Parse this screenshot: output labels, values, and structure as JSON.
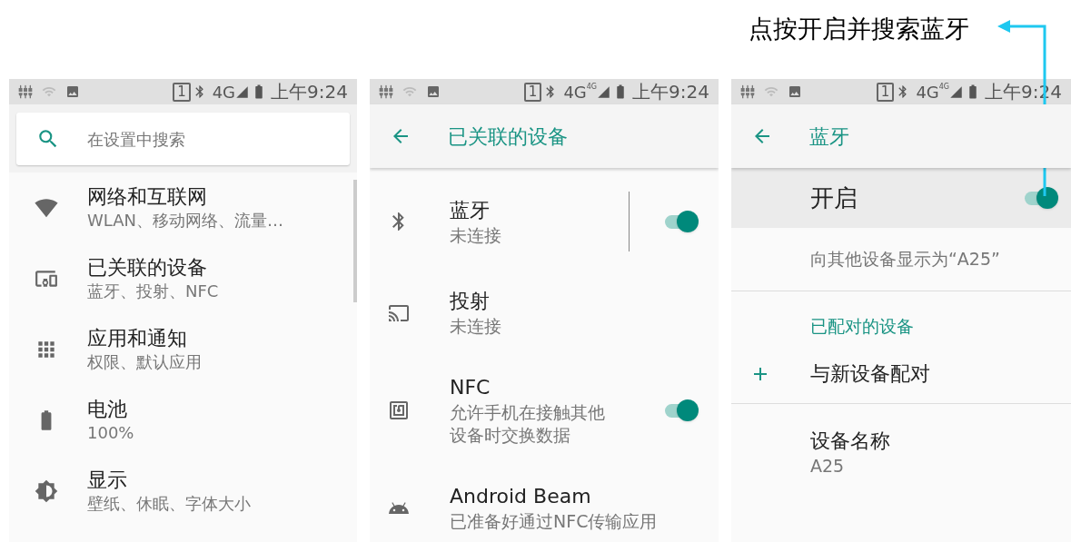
{
  "callout": {
    "text": "点按开启并搜索蓝牙"
  },
  "panels": [
    {
      "kind": "home",
      "status_bar": {
        "sim": "1",
        "network": "4G",
        "time": "上午9:24"
      },
      "search": {
        "placeholder": "在设置中搜索"
      },
      "items": [
        {
          "title": "网络和互联网",
          "subtitle": "WLAN、移动网络、流量…"
        },
        {
          "title": "已关联的设备",
          "subtitle": "蓝牙、投射、NFC"
        },
        {
          "title": "应用和通知",
          "subtitle": "权限、默认应用"
        },
        {
          "title": "电池",
          "subtitle": "100%"
        },
        {
          "title": "显示",
          "subtitle": "壁纸、休眠、字体大小"
        }
      ]
    },
    {
      "kind": "list",
      "status_bar": {
        "sim": "1",
        "network": "4G",
        "network_badge": "4G",
        "time": "上午9:24"
      },
      "header": {
        "title": "已关联的设备"
      },
      "items": [
        {
          "title": "蓝牙",
          "subtitle": "未连接",
          "toggle": {
            "on": true
          },
          "separator": true
        },
        {
          "title": "投射",
          "subtitle": "未连接"
        },
        {
          "title": "NFC",
          "subtitle": "允许手机在接触其他设备时交换数据",
          "toggle": {
            "on": true
          }
        },
        {
          "title": "Android Beam",
          "subtitle": "已准备好通过NFC传输应用"
        }
      ]
    },
    {
      "kind": "bluetooth",
      "status_bar": {
        "sim": "1",
        "network": "4G",
        "network_badge": "4G",
        "time": "上午9:24"
      },
      "header": {
        "title": "蓝牙"
      },
      "items": [
        {
          "kind": "switch",
          "title": "开启",
          "highlighted": true,
          "toggle": {
            "on": true
          }
        },
        {
          "kind": "summary",
          "title": "向其他设备显示为“A25”"
        },
        {
          "kind": "category",
          "title": "已配对的设备"
        },
        {
          "kind": "action",
          "title": "与新设备配对"
        },
        {
          "kind": "detail",
          "title": "设备名称",
          "subtitle": "A25"
        }
      ]
    }
  ]
}
